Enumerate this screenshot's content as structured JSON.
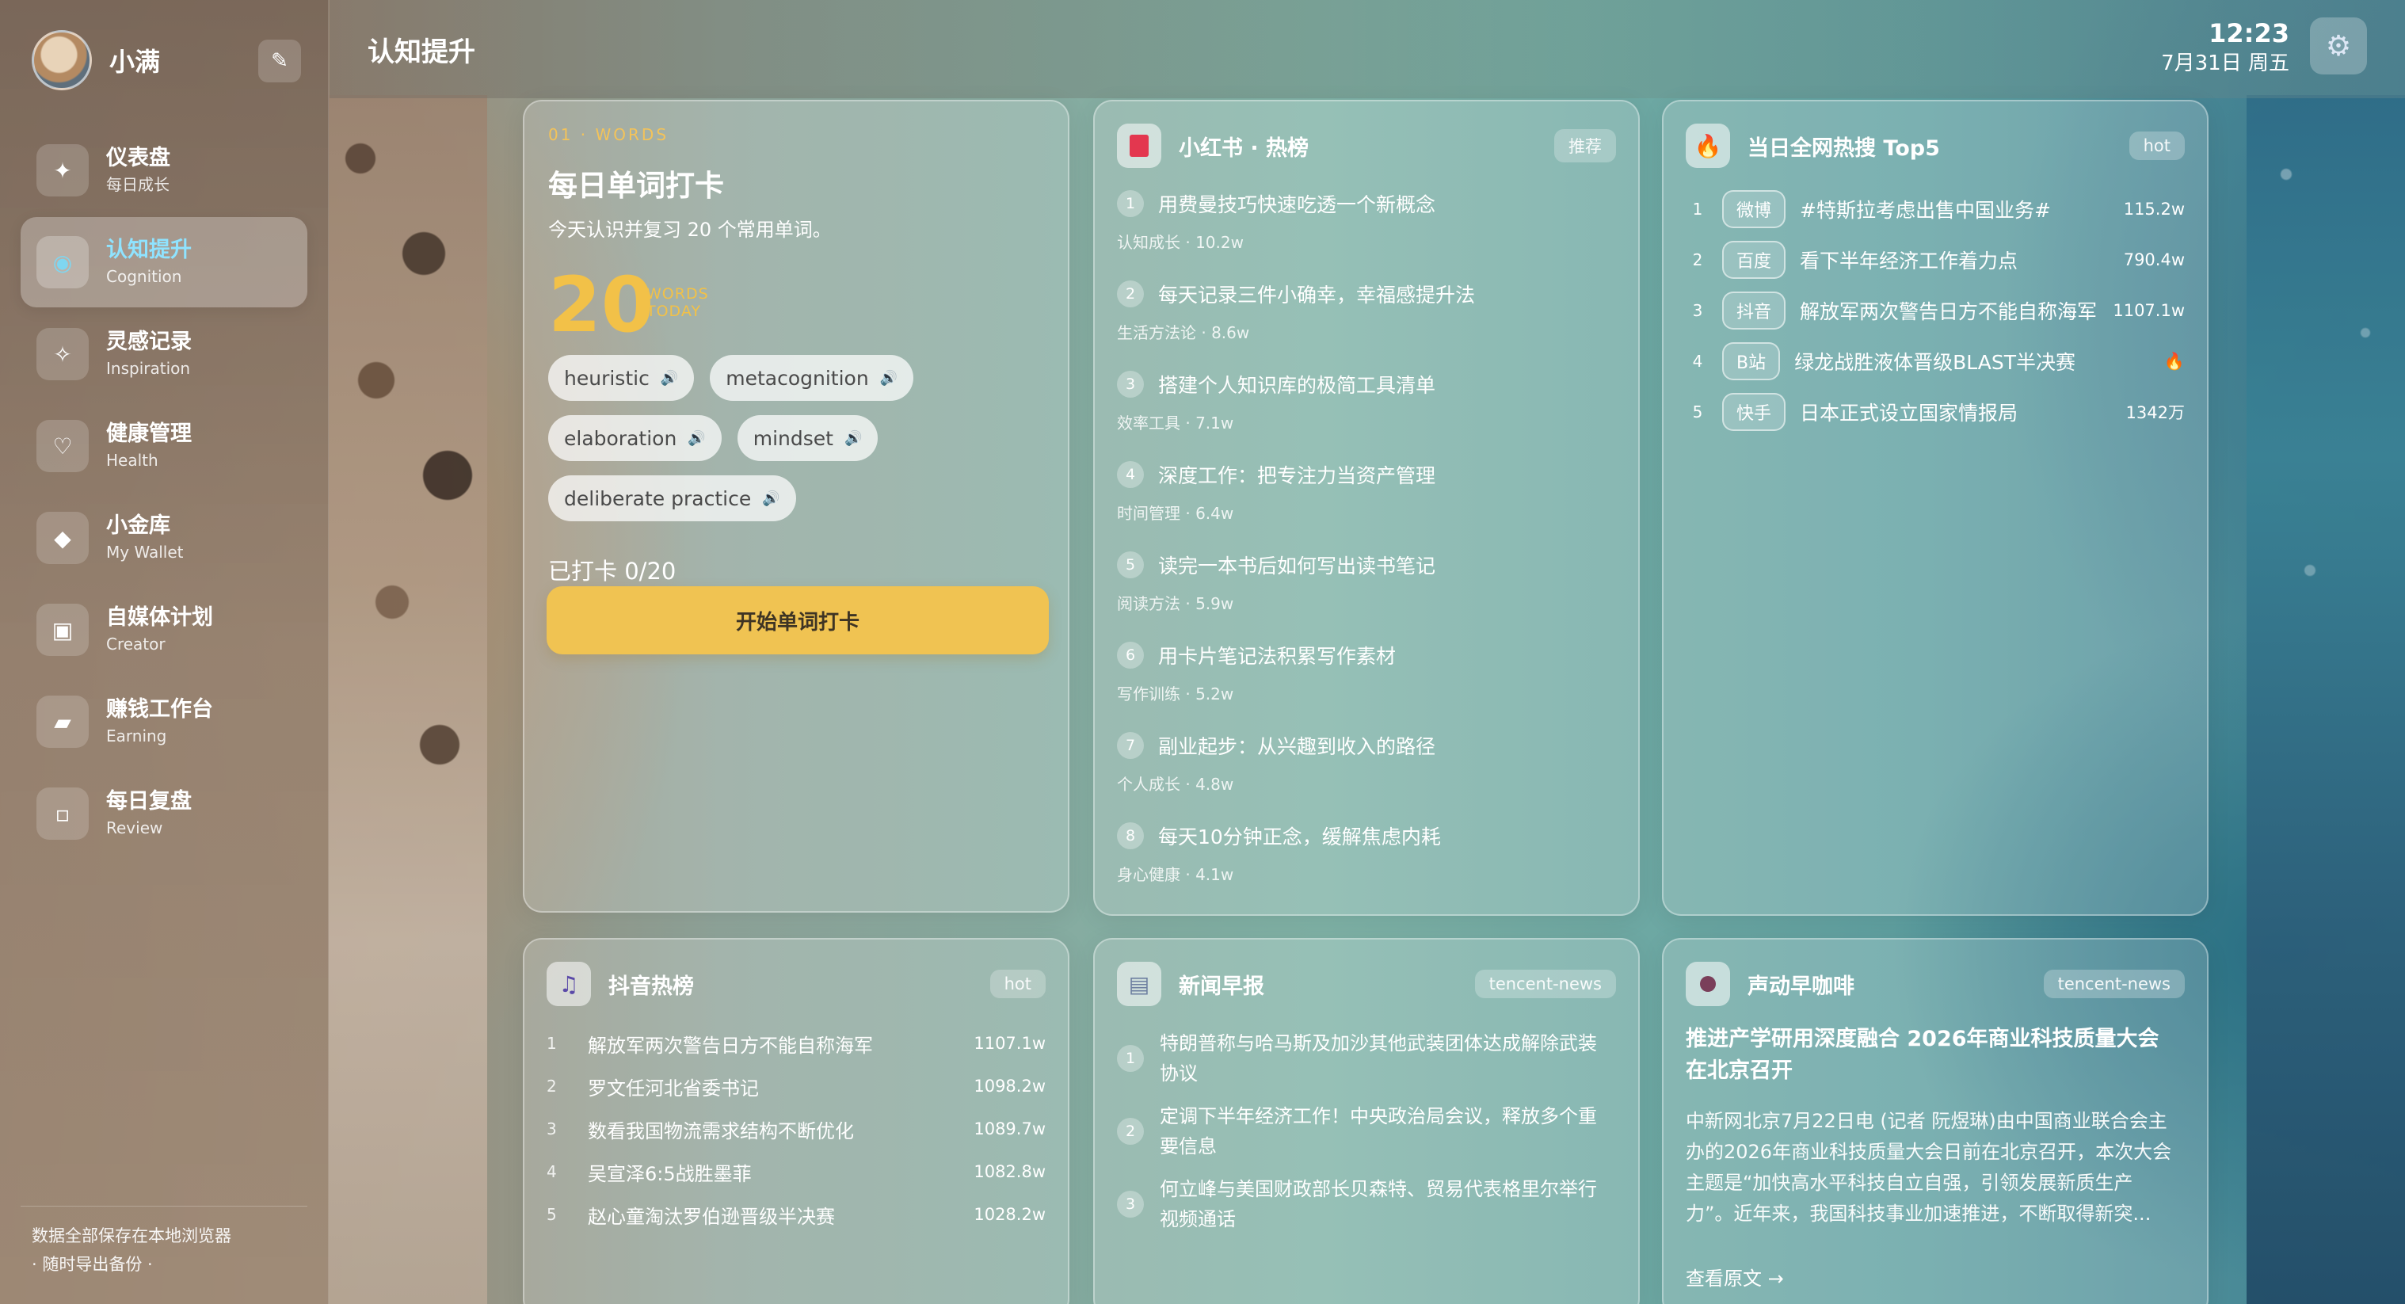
{
  "sidebar": {
    "user": {
      "name": "小满"
    },
    "edit_icon": "pencil-icon",
    "items": [
      {
        "title": "仪表盘",
        "sub": "每日成长",
        "icon": "sparkle-icon",
        "glyph": "✦",
        "active": false
      },
      {
        "title": "认知提升",
        "sub": "Cognition",
        "icon": "circle-icon",
        "glyph": "◉",
        "active": true
      },
      {
        "title": "灵感记录",
        "sub": "Inspiration",
        "icon": "star-outline-icon",
        "glyph": "✧",
        "active": false
      },
      {
        "title": "健康管理",
        "sub": "Health",
        "icon": "heart-icon",
        "glyph": "♡",
        "active": false
      },
      {
        "title": "小金库",
        "sub": "My Wallet",
        "icon": "diamond-icon",
        "glyph": "◆",
        "active": false
      },
      {
        "title": "自媒体计划",
        "sub": "Creator",
        "icon": "square-icon",
        "glyph": "▣",
        "active": false
      },
      {
        "title": "赚钱工作台",
        "sub": "Earning",
        "icon": "parallelogram-icon",
        "glyph": "▰",
        "active": false
      },
      {
        "title": "每日复盘",
        "sub": "Review",
        "icon": "dot-square-icon",
        "glyph": "▫",
        "active": false
      }
    ],
    "footer_line1": "数据全部保存在本地浏览器",
    "footer_line2": "· 随时导出备份 ·"
  },
  "header": {
    "title": "认知提升",
    "time": "12:23",
    "date": "7月31日 周五"
  },
  "words": {
    "label": "01 · WORDS",
    "title": "每日单词打卡",
    "desc": "今天认识并复习 20 个常用单词。",
    "count": "20",
    "count_label_1": "WORDS",
    "count_label_2": "TODAY",
    "chips": [
      "heuristic",
      "metacognition",
      "elaboration",
      "mindset",
      "deliberate practice"
    ],
    "progress": "已打卡 0/20",
    "button": "开始单词打卡"
  },
  "xhs": {
    "title": "小红书 · 热榜",
    "tag": "推荐",
    "items": [
      {
        "n": "1",
        "title": "用费曼技巧快速吃透一个新概念",
        "meta": "认知成长 · 10.2w"
      },
      {
        "n": "2",
        "title": "每天记录三件小确幸，幸福感提升法",
        "meta": "生活方法论 · 8.6w"
      },
      {
        "n": "3",
        "title": "搭建个人知识库的极简工具清单",
        "meta": "效率工具 · 7.1w"
      },
      {
        "n": "4",
        "title": "深度工作：把专注力当资产管理",
        "meta": "时间管理 · 6.4w"
      },
      {
        "n": "5",
        "title": "读完一本书后如何写出读书笔记",
        "meta": "阅读方法 · 5.9w"
      },
      {
        "n": "6",
        "title": "用卡片笔记法积累写作素材",
        "meta": "写作训练 · 5.2w"
      },
      {
        "n": "7",
        "title": "副业起步：从兴趣到收入的路径",
        "meta": "个人成长 · 4.8w"
      },
      {
        "n": "8",
        "title": "每天10分钟正念，缓解焦虑内耗",
        "meta": "身心健康 · 4.1w"
      }
    ]
  },
  "top5": {
    "title": "当日全网热搜 Top5",
    "tag": "hot",
    "items": [
      {
        "n": "1",
        "platform": "微博",
        "title": "#特斯拉考虑出售中国业务#",
        "value": "115.2w"
      },
      {
        "n": "2",
        "platform": "百度",
        "title": "看下半年经济工作着力点",
        "value": "790.4w"
      },
      {
        "n": "3",
        "platform": "抖音",
        "title": "解放军两次警告日方不能自称海军",
        "value": "1107.1w"
      },
      {
        "n": "4",
        "platform": "B站",
        "title": "绿龙战胜液体晋级BLAST半决赛",
        "value": "🔥"
      },
      {
        "n": "5",
        "platform": "快手",
        "title": "日本正式设立国家情报局",
        "value": "1342万"
      }
    ]
  },
  "douyin": {
    "title": "抖音热榜",
    "tag": "hot",
    "items": [
      {
        "n": "1",
        "title": "解放军两次警告日方不能自称海军",
        "value": "1107.1w"
      },
      {
        "n": "2",
        "title": "罗文任河北省委书记",
        "value": "1098.2w"
      },
      {
        "n": "3",
        "title": "数看我国物流需求结构不断优化",
        "value": "1089.7w"
      },
      {
        "n": "4",
        "title": "吴宣泽6:5战胜墨菲",
        "value": "1082.8w"
      },
      {
        "n": "5",
        "title": "赵心童淘汰罗伯逊晋级半决赛",
        "value": "1028.2w"
      }
    ]
  },
  "news": {
    "title": "新闻早报",
    "tag": "tencent-news",
    "items": [
      {
        "n": "1",
        "title": "特朗普称与哈马斯及加沙其他武装团体达成解除武装协议"
      },
      {
        "n": "2",
        "title": "定调下半年经济工作！中央政治局会议，释放多个重要信息"
      },
      {
        "n": "3",
        "title": "何立峰与美国财政部长贝森特、贸易代表格里尔举行视频通话"
      }
    ]
  },
  "coffee": {
    "title": "声动早咖啡",
    "tag": "tencent-news",
    "headline": "推进产学研用深度融合 2026年商业科技质量大会在北京召开",
    "body": "中新网北京7月22日电 (记者 阮煜琳)由中国商业联合会主办的2026年商业科技质量大会日前在北京召开，本次大会主题是“加快高水平科技自立自强，引领发展新质生产力”。近年来，我国科技事业加速推进，不断取得新突...",
    "link": "查看原文 →"
  }
}
